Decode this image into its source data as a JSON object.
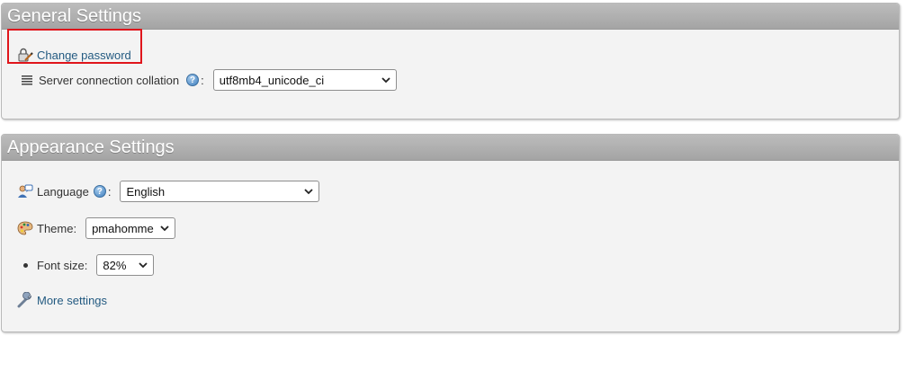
{
  "general": {
    "title": "General Settings",
    "change_password_label": "Change password",
    "collation_label": "Server connection collation",
    "collation_value": "utf8mb4_unicode_ci"
  },
  "appearance": {
    "title": "Appearance Settings",
    "language_label": "Language",
    "language_value": "English",
    "theme_label": "Theme:",
    "theme_value": "pmahomme",
    "font_size_label": "Font size:",
    "font_size_value": "82%",
    "more_settings_label": "More settings"
  },
  "help_glyph": "?",
  "colon": ":",
  "icons": {
    "change_password": "lock-pen-icon",
    "collation": "list-lines-icon",
    "help": "help-icon",
    "language": "language-person-icon",
    "theme": "palette-icon",
    "more_settings": "wrench-icon",
    "dropdown": "chevron-down-icon"
  },
  "colors": {
    "link": "#235a81",
    "header_bg": "#a4a4a4",
    "panel_bg": "#f3f3f3",
    "highlight": "#e0151b"
  }
}
